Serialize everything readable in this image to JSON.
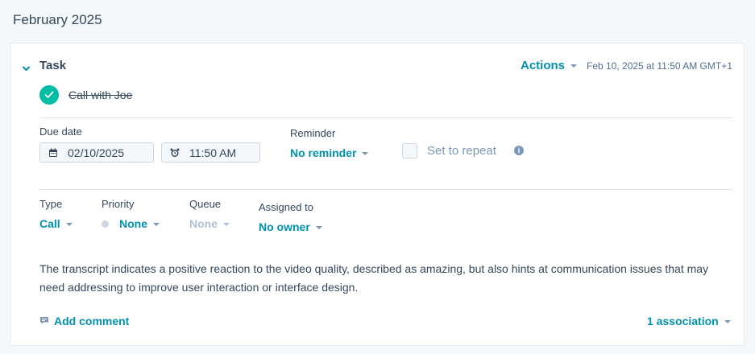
{
  "timeline": {
    "month": "February 2025"
  },
  "task": {
    "heading": "Task",
    "actions_label": "Actions",
    "timestamp": "Feb 10, 2025 at 11:50 AM GMT+1",
    "title": "Call with Joe",
    "completed": true,
    "due_date_label": "Due date",
    "due_date_value": "02/10/2025",
    "due_time_value": "11:50 AM",
    "reminder_label": "Reminder",
    "reminder_value": "No reminder",
    "repeat_label": "Set to repeat",
    "info_glyph": "i",
    "type_label": "Type",
    "type_value": "Call",
    "priority_label": "Priority",
    "priority_value": "None",
    "queue_label": "Queue",
    "queue_value": "None",
    "assigned_label": "Assigned to",
    "assigned_value": "No owner",
    "description": "The transcript indicates a positive reaction to the video quality, described as amazing, but also hints at communication issues that may need addressing to improve user interaction or interface design.",
    "add_comment_label": "Add comment",
    "association_label": "1 association"
  },
  "icons": {
    "collapse": "chevron-down-icon",
    "complete": "check-icon",
    "calendar": "calendar-icon",
    "clock": "alarm-clock-icon",
    "info": "info-icon",
    "comment": "comment-icon"
  },
  "colors": {
    "accent": "#0091ae",
    "success": "#00bda5",
    "text": "#33475b",
    "muted": "#7c98b6",
    "background": "#f5f8fa"
  }
}
